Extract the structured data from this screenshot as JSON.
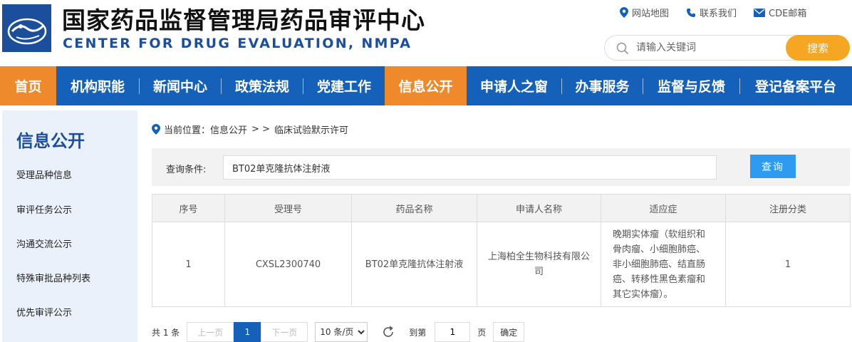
{
  "header": {
    "title_cn": "国家药品监督管理局药品审评中心",
    "title_en": "CENTER FOR DRUG EVALUATION, NMPA",
    "links": [
      "网站地图",
      "联系我们",
      "CDE邮箱"
    ],
    "search": {
      "placeholder": "请输入关键词",
      "button": "搜索"
    }
  },
  "nav": {
    "items": [
      "首页",
      "机构职能",
      "新闻中心",
      "政策法规",
      "党建工作",
      "信息公开",
      "申请人之窗",
      "办事服务",
      "监督与反馈",
      "登记备案平台"
    ],
    "active": [
      "首页",
      "信息公开"
    ]
  },
  "sidebar": {
    "title": "信息公开",
    "items": [
      "受理品种信息",
      "审评任务公示",
      "沟通交流公示",
      "特殊审批品种列表",
      "优先审评公示"
    ]
  },
  "breadcrumb": {
    "prefix": "当前位置：信息公开",
    "sep": "> >",
    "current": "临床试验默示许可"
  },
  "query": {
    "label": "查询条件:",
    "value": "BT02单克隆抗体注射液",
    "button": "查询"
  },
  "table": {
    "columns": [
      "序号",
      "受理号",
      "药品名称",
      "申请人名称",
      "适应症",
      "注册分类"
    ],
    "rows": [
      {
        "no": "1",
        "accept_no": "CXSL2300740",
        "drug_name": "BT02单克隆抗体注射液",
        "applicant": "上海柏全生物科技有限公司",
        "indication": "晚期实体瘤（软组织和骨肉瘤、小细胞肺癌、非小细胞肺癌、结直肠癌、转移性黑色素瘤和其它实体瘤）。",
        "category": "1"
      }
    ]
  },
  "pager": {
    "total": "共 1 条",
    "prev": "上一页",
    "page": "1",
    "next": "下一页",
    "page_size": "10 条/页",
    "goto_label": "到第",
    "goto_value": "1",
    "page_unit": "页",
    "confirm": "确定"
  },
  "colors": {
    "nav_bg": "#1560b8",
    "nav_active": "#ee8a2c",
    "search_button": "#f5a623",
    "query_button": "#2d9bf0",
    "brand_blue": "#1b4f9c"
  }
}
